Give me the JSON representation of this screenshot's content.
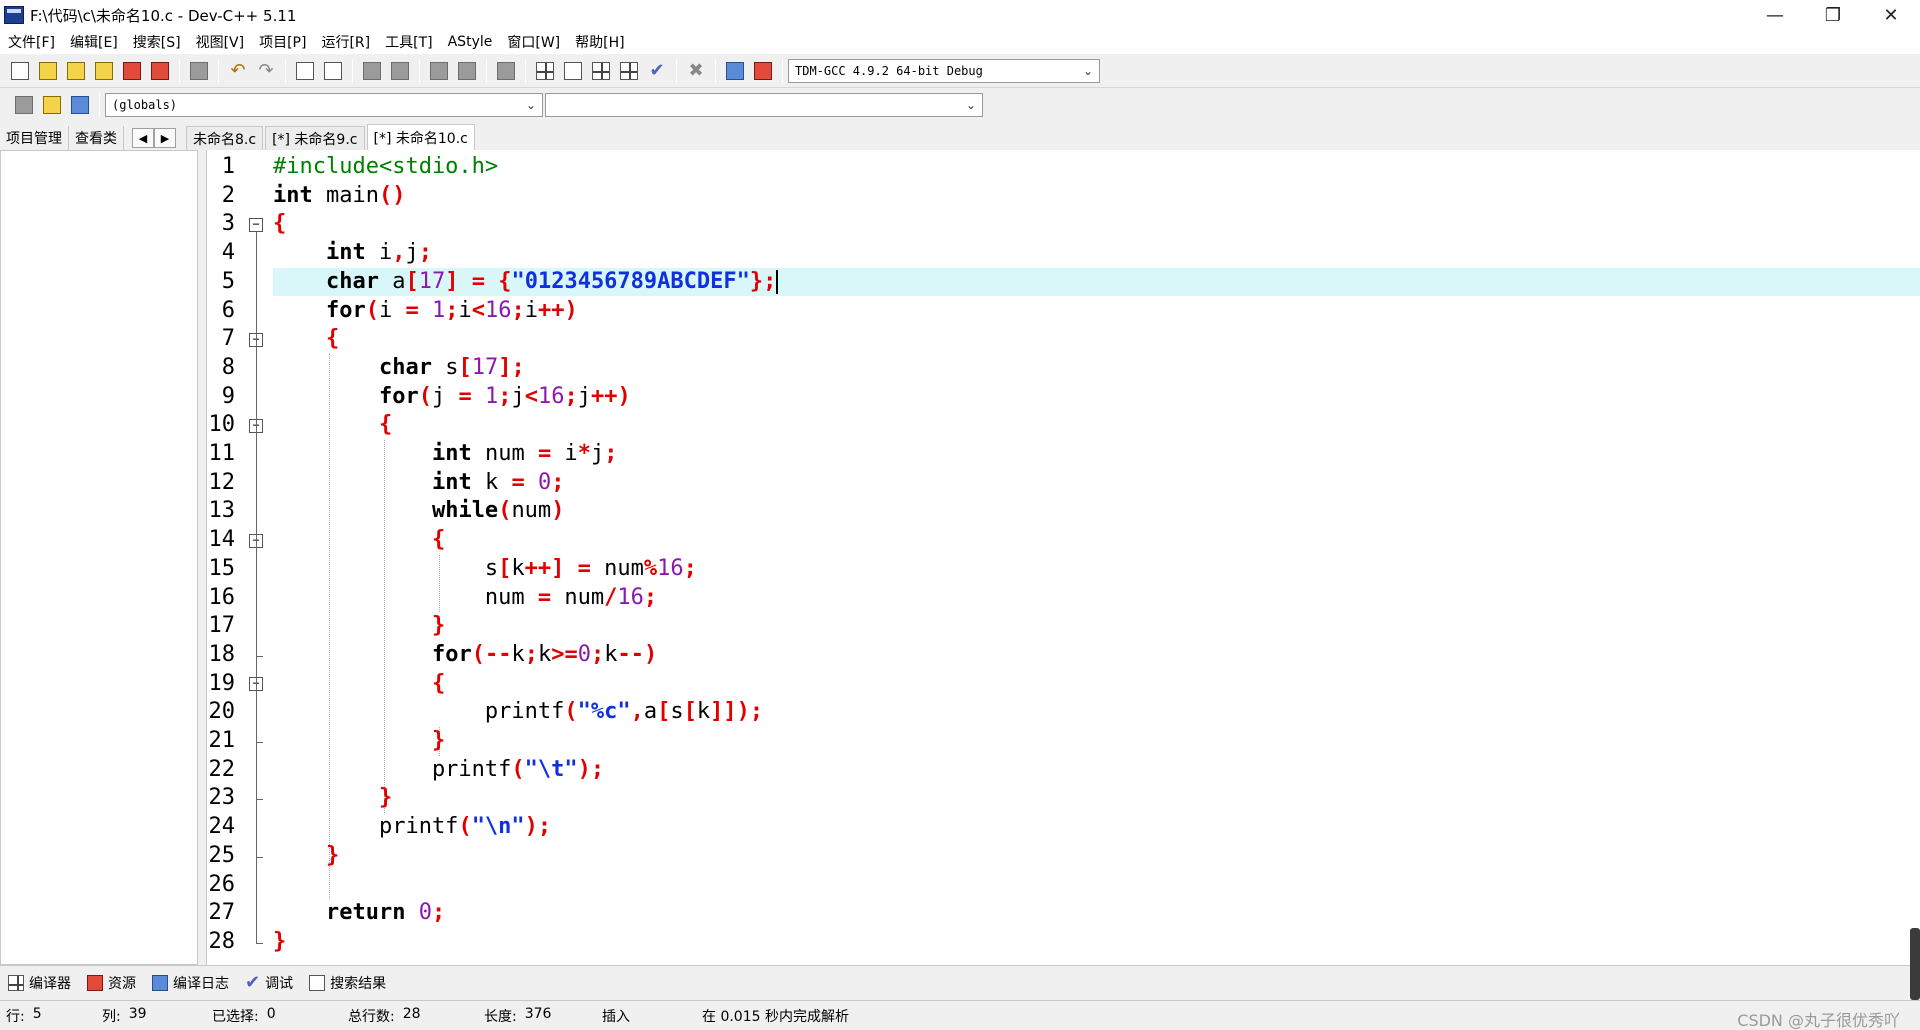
{
  "window": {
    "title": "F:\\代码\\c\\未命名10.c - Dev-C++ 5.11",
    "controls": [
      "—",
      "❐",
      "✕"
    ]
  },
  "menu": [
    "文件[F]",
    "编辑[E]",
    "搜索[S]",
    "视图[V]",
    "项目[P]",
    "运行[R]",
    "工具[T]",
    "AStyle",
    "窗口[W]",
    "帮助[H]"
  ],
  "toolbar": {
    "compiler_select": "TDM-GCC 4.9.2 64-bit Debug",
    "scope_select": "(globals)",
    "member_select": ""
  },
  "left_tabs": [
    "项目管理",
    "查看类"
  ],
  "nav_arrows": [
    "◀",
    "▶"
  ],
  "file_tabs": [
    "未命名8.c",
    "[*] 未命名9.c",
    "[*] 未命名10.c"
  ],
  "editor": {
    "active_line": 5,
    "line_numbers": [
      "1",
      "2",
      "3",
      "4",
      "5",
      "6",
      "7",
      "8",
      "9",
      "10",
      "11",
      "12",
      "13",
      "14",
      "15",
      "16",
      "17",
      "18",
      "19",
      "20",
      "21",
      "22",
      "23",
      "24",
      "25",
      "26",
      "27",
      "28"
    ],
    "fold_marker": "−"
  },
  "bottom_tabs": [
    "编译器",
    "资源",
    "编译日志",
    "调试",
    "搜索结果"
  ],
  "status": {
    "row_label": "行:",
    "row": "5",
    "col_label": "列:",
    "col": "39",
    "sel_label": "已选择:",
    "sel": "0",
    "total_label": "总行数:",
    "total": "28",
    "len_label": "长度:",
    "len": "376",
    "mode": "插入",
    "parse_msg": "在 0.015 秒内完成解析"
  },
  "watermark": "CSDN @丸子很优秀吖"
}
